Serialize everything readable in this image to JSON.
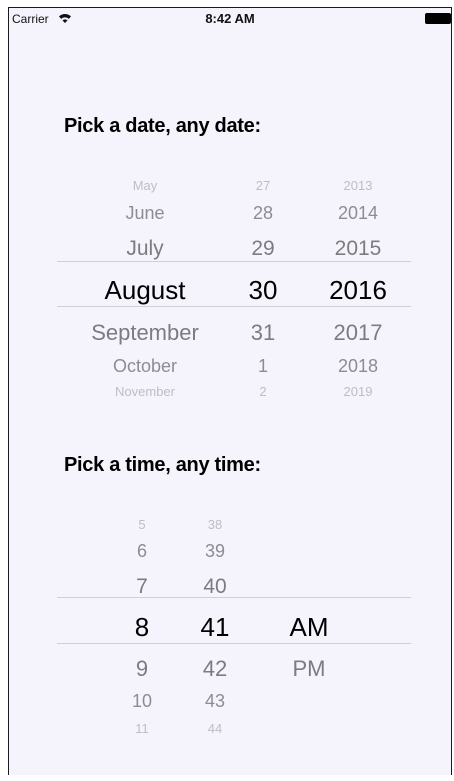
{
  "status_bar": {
    "carrier": "Carrier",
    "time": "8:42 AM"
  },
  "date_section": {
    "title": "Pick a date, any date:",
    "months": [
      "May",
      "June",
      "July",
      "August",
      "September",
      "October",
      "November"
    ],
    "days": [
      "27",
      "28",
      "29",
      "30",
      "31",
      "1",
      "2"
    ],
    "years": [
      "2013",
      "2014",
      "2015",
      "2016",
      "2017",
      "2018",
      "2019"
    ],
    "selected": {
      "month": "August",
      "day": "30",
      "year": "2016"
    }
  },
  "time_section": {
    "title": "Pick a time, any time:",
    "hours": [
      "5",
      "6",
      "7",
      "8",
      "9",
      "10",
      "11"
    ],
    "minutes": [
      "38",
      "39",
      "40",
      "41",
      "42",
      "43",
      "44"
    ],
    "periods": [
      "AM",
      "PM"
    ],
    "selected": {
      "hour": "8",
      "minute": "41",
      "period": "AM"
    }
  }
}
